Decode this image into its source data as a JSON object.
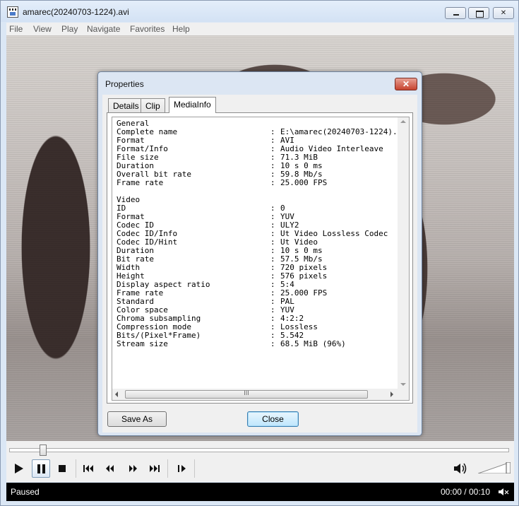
{
  "window": {
    "title": "amarec(20240703-1224).avi"
  },
  "menu": [
    "File",
    "View",
    "Play",
    "Navigate",
    "Favorites",
    "Help"
  ],
  "dialog": {
    "title": "Properties",
    "tabs": [
      "Details",
      "Clip",
      "MediaInfo"
    ],
    "active_tab": "MediaInfo",
    "info_lines": [
      {
        "key": "General",
        "value": ""
      },
      {
        "key": "Complete name",
        "value": "E:\\amarec(20240703-1224)."
      },
      {
        "key": "Format",
        "value": "AVI"
      },
      {
        "key": "Format/Info",
        "value": "Audio Video Interleave"
      },
      {
        "key": "File size",
        "value": "71.3 MiB"
      },
      {
        "key": "Duration",
        "value": "10 s 0 ms"
      },
      {
        "key": "Overall bit rate",
        "value": "59.8 Mb/s"
      },
      {
        "key": "Frame rate",
        "value": "25.000 FPS"
      },
      {
        "key": "",
        "value": ""
      },
      {
        "key": "Video",
        "value": ""
      },
      {
        "key": "ID",
        "value": "0"
      },
      {
        "key": "Format",
        "value": "YUV"
      },
      {
        "key": "Codec ID",
        "value": "ULY2"
      },
      {
        "key": "Codec ID/Info",
        "value": "Ut Video Lossless Codec"
      },
      {
        "key": "Codec ID/Hint",
        "value": "Ut Video"
      },
      {
        "key": "Duration",
        "value": "10 s 0 ms"
      },
      {
        "key": "Bit rate",
        "value": "57.5 Mb/s"
      },
      {
        "key": "Width",
        "value": "720 pixels"
      },
      {
        "key": "Height",
        "value": "576 pixels"
      },
      {
        "key": "Display aspect ratio",
        "value": "5:4"
      },
      {
        "key": "Frame rate",
        "value": "25.000 FPS"
      },
      {
        "key": "Standard",
        "value": "PAL"
      },
      {
        "key": "Color space",
        "value": "YUV"
      },
      {
        "key": "Chroma subsampling",
        "value": "4:2:2"
      },
      {
        "key": "Compression mode",
        "value": "Lossless"
      },
      {
        "key": "Bits/(Pixel*Frame)",
        "value": "5.542"
      },
      {
        "key": "Stream size",
        "value": "68.5 MiB (96%)"
      }
    ],
    "separator": ":",
    "scroll_grip": "III",
    "close_glyph": "✕",
    "save_as_label": "Save As",
    "close_label": "Close"
  },
  "player": {
    "seek_position_fraction": 0.06,
    "volume_fraction": 1.0
  },
  "status": {
    "state": "Paused",
    "time": "00:00 / 00:10"
  }
}
